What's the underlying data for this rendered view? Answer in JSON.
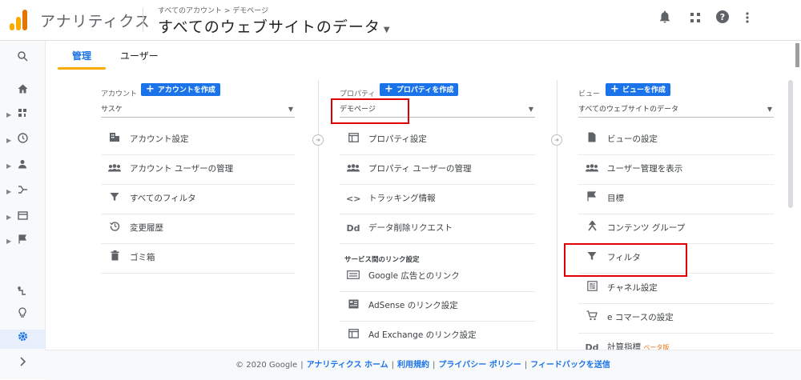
{
  "header": {
    "app_name": "アナリティクス",
    "breadcrumb": "すべてのアカウント > デモページ",
    "view_title": "すべてのウェブサイトのデータ",
    "icons": [
      "bell-icon",
      "apps-icon",
      "help-icon",
      "more-vert-icon"
    ]
  },
  "leftnav": {
    "items": [
      "search",
      "home",
      "customization",
      "realtime",
      "audience",
      "acquisition",
      "behavior",
      "conversions",
      "attribution",
      "discover",
      "admin",
      "collapse"
    ]
  },
  "tabs": [
    {
      "label": "管理",
      "active": true
    },
    {
      "label": "ユーザー",
      "active": false
    }
  ],
  "account": {
    "label": "アカウント",
    "create_label": "アカウントを作成",
    "selected": "サスケ",
    "rows": [
      {
        "icon": "building-icon",
        "label": "アカウント設定"
      },
      {
        "icon": "users-icon",
        "label": "アカウント ユーザーの管理"
      },
      {
        "icon": "filter-icon",
        "label": "すべてのフィルタ"
      },
      {
        "icon": "history-icon",
        "label": "変更履歴"
      },
      {
        "icon": "trash-icon",
        "label": "ゴミ箱"
      }
    ]
  },
  "property": {
    "label": "プロパティ",
    "create_label": "プロパティを作成",
    "selected": "デモページ",
    "rows": [
      {
        "icon": "window-icon",
        "label": "プロパティ設定"
      },
      {
        "icon": "users-icon",
        "label": "プロパティ ユーザーの管理"
      },
      {
        "icon": "code-icon",
        "label": "トラッキング情報"
      },
      {
        "icon": "dd-icon",
        "label": "データ削除リクエスト"
      }
    ],
    "section_title": "サービス間のリンク設定",
    "link_rows": [
      {
        "icon": "google-ads-icon",
        "label": "Google 広告とのリンク"
      },
      {
        "icon": "adsense-icon",
        "label": "AdSense のリンク設定"
      },
      {
        "icon": "adexchange-icon",
        "label": "Ad Exchange のリンク設定"
      }
    ]
  },
  "view": {
    "label": "ビュー",
    "create_label": "ビューを作成",
    "selected": "すべてのウェブサイトのデータ",
    "rows": [
      {
        "icon": "document-icon",
        "label": "ビューの設定"
      },
      {
        "icon": "users-icon",
        "label": "ユーザー管理を表示"
      },
      {
        "icon": "flag-icon",
        "label": "目標"
      },
      {
        "icon": "content-group-icon",
        "label": "コンテンツ グループ"
      },
      {
        "icon": "filter-icon",
        "label": "フィルタ"
      },
      {
        "icon": "channel-icon",
        "label": "チャネル設定"
      },
      {
        "icon": "cart-icon",
        "label": "e コマースの設定"
      },
      {
        "icon": "dd-icon",
        "label": "計算指標",
        "badge": "ベータ版"
      }
    ]
  },
  "footer": {
    "copyright": "© 2020 Google",
    "links": [
      "アナリティクス ホーム",
      "利用規約",
      "プライバシー ポリシー",
      "フィードバックを送信"
    ]
  },
  "colors": {
    "accent": "#1a73e8",
    "highlight": "#e00000",
    "tab_underline": "#f9ab00"
  }
}
